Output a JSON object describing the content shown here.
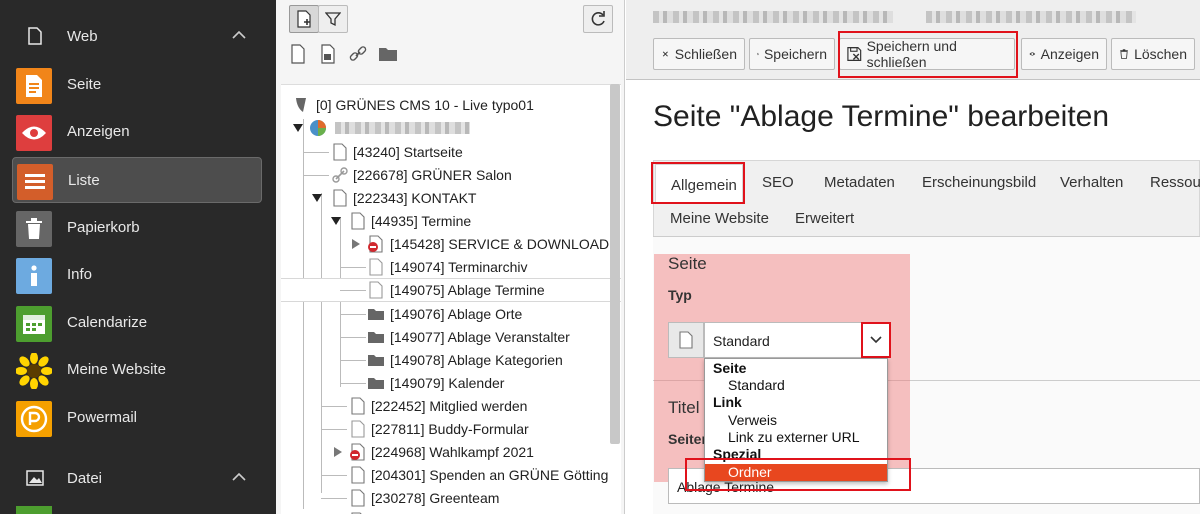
{
  "modmenu": {
    "groups": [
      {
        "label": "Web",
        "icon": "document-icon"
      },
      {
        "label": "Datei",
        "icon": "image-icon"
      }
    ],
    "items": [
      {
        "label": "Seite",
        "icon": "page-module-icon",
        "color": "#f18519"
      },
      {
        "label": "Anzeigen",
        "icon": "eye-module-icon",
        "color": "#de3e3e"
      },
      {
        "label": "Liste",
        "icon": "list-module-icon",
        "color": "#d35e2a"
      },
      {
        "label": "Papierkorb",
        "icon": "trash-module-icon",
        "color": "#666666"
      },
      {
        "label": "Info",
        "icon": "info-module-icon",
        "color": "#6daae0"
      },
      {
        "label": "Calendarize",
        "icon": "calendar-module-icon",
        "color": "#4d9e2f"
      },
      {
        "label": "Meine Website",
        "icon": "sunflower-icon",
        "color": "#ffd400"
      },
      {
        "label": "Powermail",
        "icon": "powermail-icon",
        "color": "#f5a000"
      }
    ]
  },
  "tree": {
    "root": "[0] GRÜNES CMS 10 - Live typo01",
    "nodes": [
      {
        "label": "[43240] Startseite"
      },
      {
        "label": "[226678] GRÜNER Salon"
      },
      {
        "label": "[222343] KONTAKT"
      },
      {
        "label": "[44935] Termine"
      },
      {
        "label": "[145428] SERVICE & DOWNLOAD"
      },
      {
        "label": "[149074] Terminarchiv"
      },
      {
        "label": "[149075] Ablage Termine"
      },
      {
        "label": "[149076] Ablage Orte"
      },
      {
        "label": "[149077] Ablage Veranstalter"
      },
      {
        "label": "[149078] Ablage Kategorien"
      },
      {
        "label": "[149079] Kalender"
      },
      {
        "label": "[222452] Mitglied werden"
      },
      {
        "label": "[227811] Buddy-Formular"
      },
      {
        "label": "[224968] Wahlkampf 2021"
      },
      {
        "label": "[204301] Spenden an GRÜNE Götting"
      },
      {
        "label": "[230278] Greenteam"
      }
    ]
  },
  "docheader": {
    "close": "Schließen",
    "save": "Speichern",
    "save_close": "Speichern und schließen",
    "view": "Anzeigen",
    "delete": "Löschen"
  },
  "page_title": "Seite \"Ablage Termine\" bearbeiten",
  "tabs": {
    "row1": [
      "Allgemein",
      "SEO",
      "Metadaten",
      "Erscheinungsbild",
      "Verhalten",
      "Ressou"
    ],
    "row2": [
      "Meine Website",
      "Erweitert"
    ]
  },
  "form": {
    "section_page": "Seite",
    "type_label": "Typ",
    "type_value": "Standard",
    "section_title": "Titel",
    "title_label": "Seiter",
    "title_value": "Ablage Termine"
  },
  "dropdown": {
    "groups": [
      {
        "label": "Seite",
        "options": [
          "Standard"
        ]
      },
      {
        "label": "Link",
        "options": [
          "Verweis",
          "Link zu externer URL"
        ]
      },
      {
        "label": "Spezial",
        "options": [
          "Ordner"
        ]
      }
    ],
    "selected": "Ordner"
  },
  "colors": {
    "highlight_border": "#e0121b",
    "option_selected": "#e8471f"
  }
}
